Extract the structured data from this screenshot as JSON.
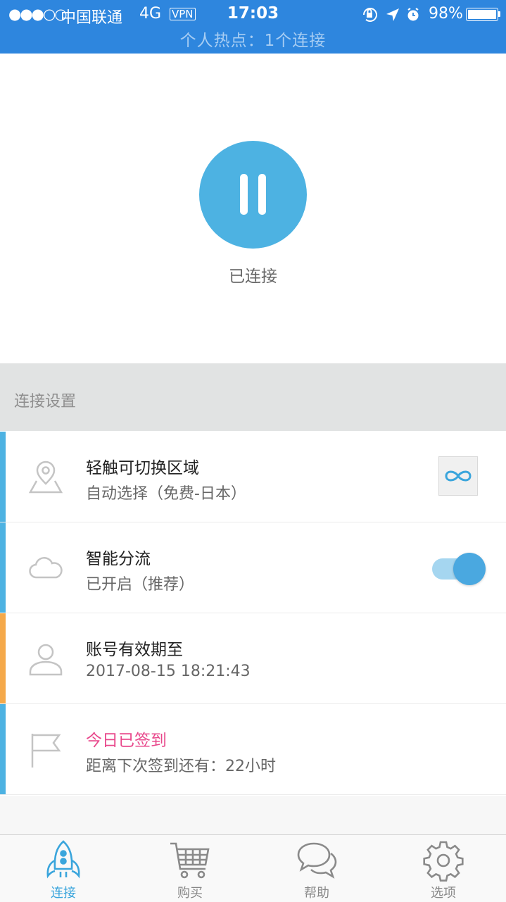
{
  "status_bar": {
    "signal": "●●●○○",
    "carrier": "中国联通",
    "network": "4G",
    "vpn": "VPN",
    "time": "17:03",
    "battery_percent": "98%",
    "battery_level": 0.98,
    "hotspot": "个人热点：1个连接",
    "icons": [
      "rotation-lock-icon",
      "location-arrow-icon",
      "alarm-icon"
    ]
  },
  "connect": {
    "status": "已连接",
    "button_icon": "pause-icon",
    "accent_color": "#4db2e2"
  },
  "section": {
    "title": "连接设置"
  },
  "rows": [
    {
      "title": "轻触可切换区域",
      "subtitle": "自动选择（免费-日本）",
      "icon": "location-pin-icon",
      "accent": "#4db2e2",
      "control": "infinity-icon"
    },
    {
      "title": "智能分流",
      "subtitle": "已开启（推荐）",
      "icon": "cloud-icon",
      "accent": "#4db2e2",
      "control": "toggle-on"
    },
    {
      "title": "账号有效期至",
      "subtitle": "2017-08-15 18:21:43",
      "icon": "user-icon",
      "accent": "#f5a94a"
    },
    {
      "title": "今日已签到",
      "subtitle": "距离下次签到还有：22小时",
      "icon": "flag-icon",
      "accent": "#4db2e2",
      "title_color": "#e8478b"
    }
  ],
  "tabs": [
    {
      "label": "连接",
      "icon": "rocket-icon",
      "active": true
    },
    {
      "label": "购买",
      "icon": "cart-icon",
      "active": false
    },
    {
      "label": "帮助",
      "icon": "chat-bubbles-icon",
      "active": false
    },
    {
      "label": "选项",
      "icon": "gear-icon",
      "active": false
    }
  ]
}
